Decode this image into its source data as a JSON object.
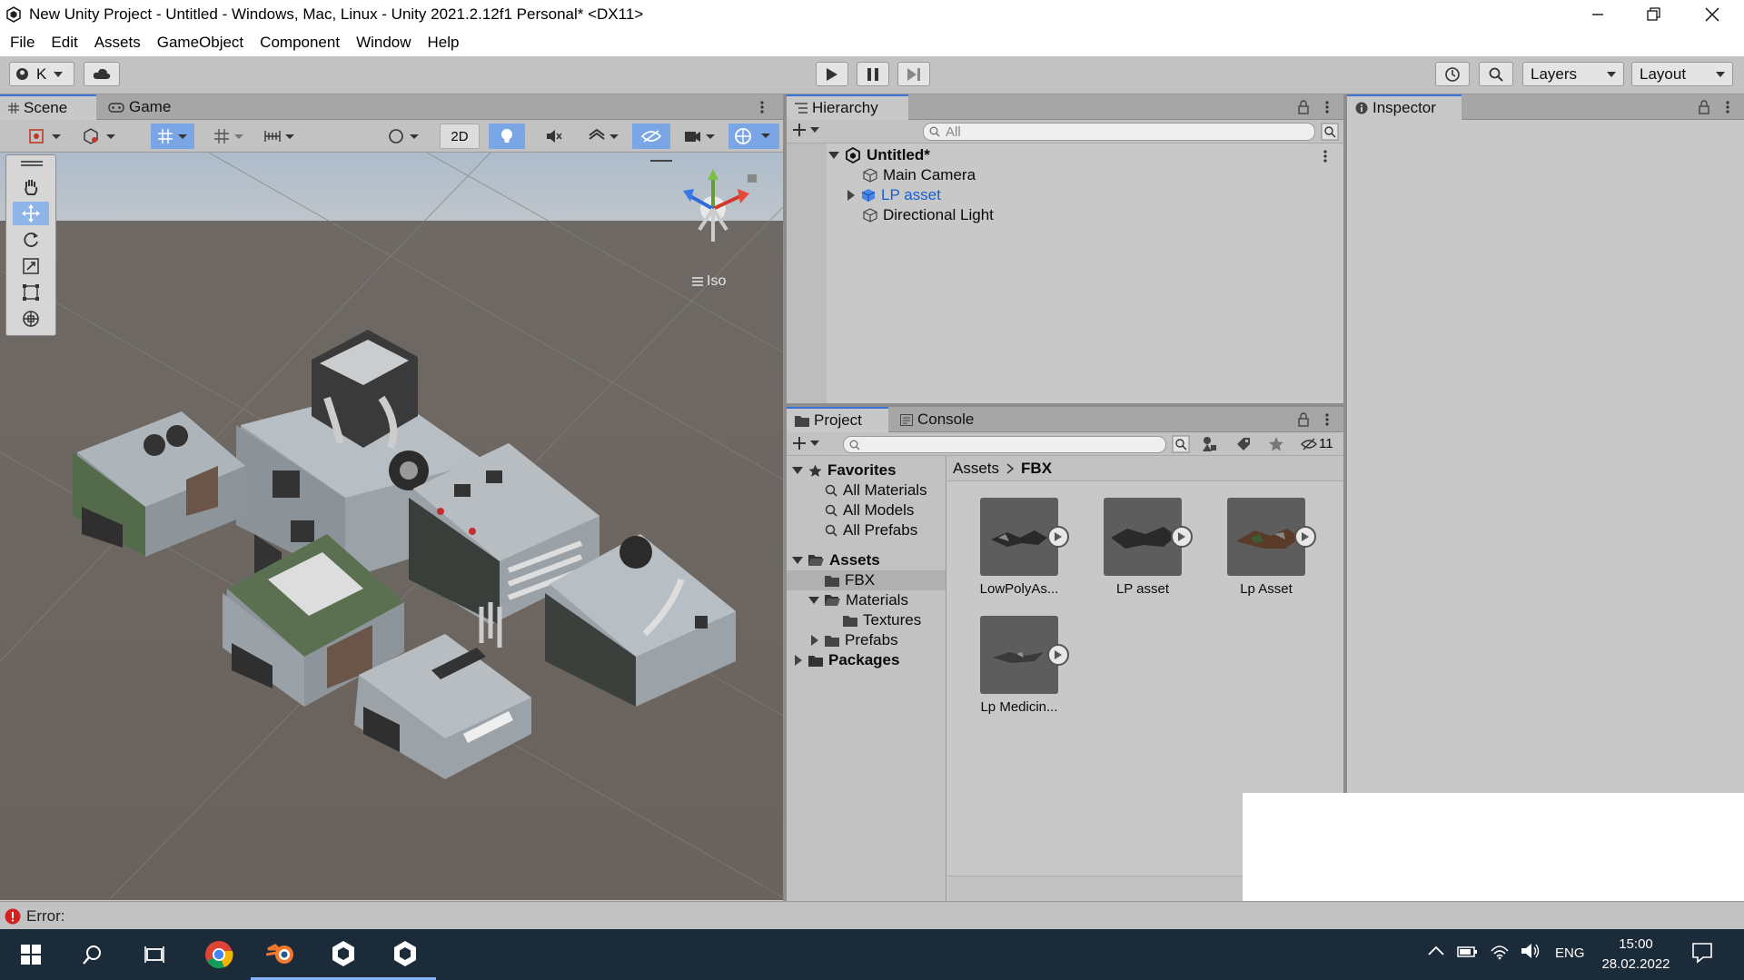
{
  "window": {
    "title": "New Unity Project - Untitled - Windows, Mac, Linux - Unity 2021.2.12f1 Personal* <DX11>"
  },
  "menu": [
    "File",
    "Edit",
    "Assets",
    "GameObject",
    "Component",
    "Window",
    "Help"
  ],
  "toolbar": {
    "account_label": "K",
    "layers_label": "Layers",
    "layout_label": "Layout"
  },
  "scene_panel": {
    "tabs": [
      "Scene",
      "Game"
    ],
    "toggle_2d": "2D",
    "projection_label": "Iso"
  },
  "hierarchy": {
    "tab": "Hierarchy",
    "search_placeholder": "All",
    "scene_name": "Untitled*",
    "items": [
      "Main Camera",
      "LP  asset",
      "Directional Light"
    ],
    "prefab_color": "#1a5fd0"
  },
  "inspector": {
    "tab": "Inspector"
  },
  "project": {
    "tabs": [
      "Project",
      "Console"
    ],
    "hidden_count": "11",
    "favorites_label": "Favorites",
    "favorites": [
      "All Materials",
      "All Models",
      "All Prefabs"
    ],
    "assets_label": "Assets",
    "folders": [
      "FBX",
      "Materials",
      "Textures",
      "Prefabs"
    ],
    "packages_label": "Packages",
    "breadcrumb": [
      "Assets",
      "FBX"
    ],
    "assets": [
      "LowPolyAs...",
      "LP  asset",
      "Lp Asset",
      "Lp Medicin..."
    ]
  },
  "status": {
    "error_text": "Error:"
  },
  "taskbar": {
    "language": "ENG",
    "time": "15:00",
    "date": "28.02.2022"
  },
  "colors": {
    "accent": "#3a72d8",
    "selection": "#7aa6e6",
    "error": "#d32020",
    "taskbar": "#1c2b3a"
  }
}
